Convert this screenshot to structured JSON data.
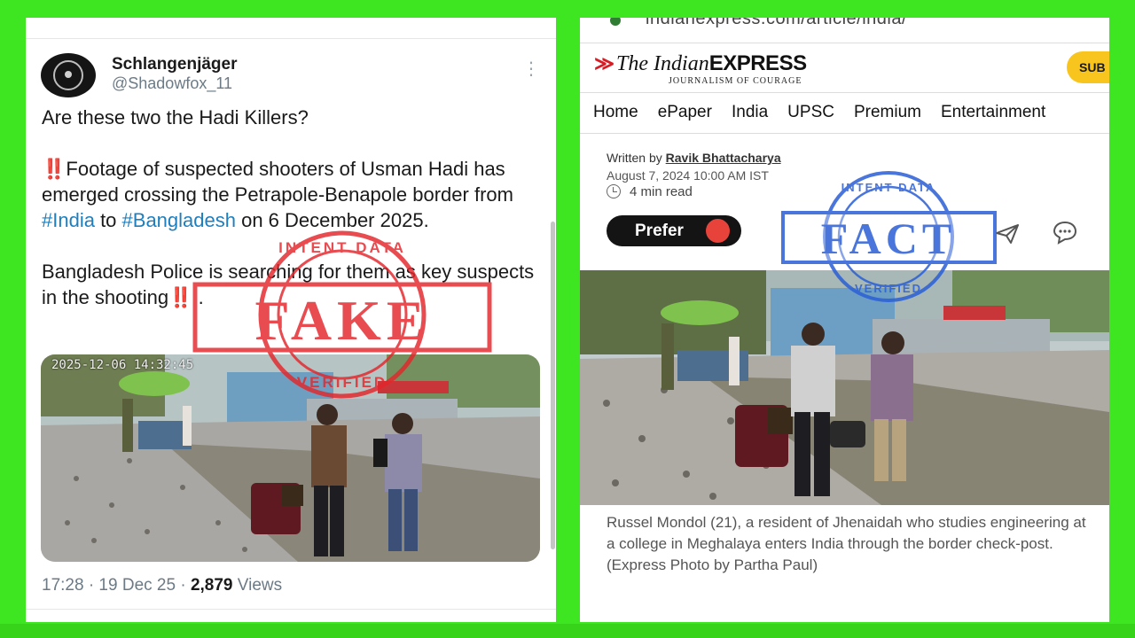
{
  "tweet": {
    "display_name": "Schlangenjäger",
    "handle": "@Shadowfox_11",
    "line1": "Are these two the Hadi Killers?",
    "para2_a": "Footage of suspected shooters of Usman Hadi has emerged crossing the Petrapole-Benapole border from ",
    "hashtag_india": "#India",
    "para2_b": " to ",
    "hashtag_bangladesh": "#Bangladesh",
    "para2_c": " on 6 December 2025.",
    "bang": "‼️",
    "para3": "Bangladesh Police is searching for them as key suspects in the shooting",
    "para3_end": " .",
    "photo_timestamp": "2025-12-06  14:32:45",
    "time": "17:28 · 19 Dec 25 · ",
    "views_count": "2,879",
    "views_label": " Views"
  },
  "article": {
    "url": "indianexpress.com/article/india/",
    "logo_the": "The ",
    "logo_indian": "Indian",
    "logo_express": "EXPRESS",
    "tagline": "JOURNALISM OF COURAGE",
    "subscribe_label": "SUB",
    "nav_items": [
      "Home",
      "ePaper",
      "India",
      "UPSC",
      "Premium",
      "Entertainment"
    ],
    "written_by_label": "Written by ",
    "author": "Ravik Bhattacharya",
    "date": "August 7, 2024 10:00 AM IST",
    "read_time": "4 min read",
    "prefer_label": "Prefer",
    "caption": "Russel Mondol (21), a resident of Jhenaidah who studies engineering at a college in Meghalaya enters India through the border check-post. (Express Photo by Partha Paul)"
  },
  "stamps": {
    "fake_word": "FAKE",
    "fact_word": "FACT",
    "ring_top": "INTENT DATA",
    "ring_bottom": "VERIFIED",
    "fake_color": "#e3262b",
    "fact_color": "#2b5fd6"
  }
}
